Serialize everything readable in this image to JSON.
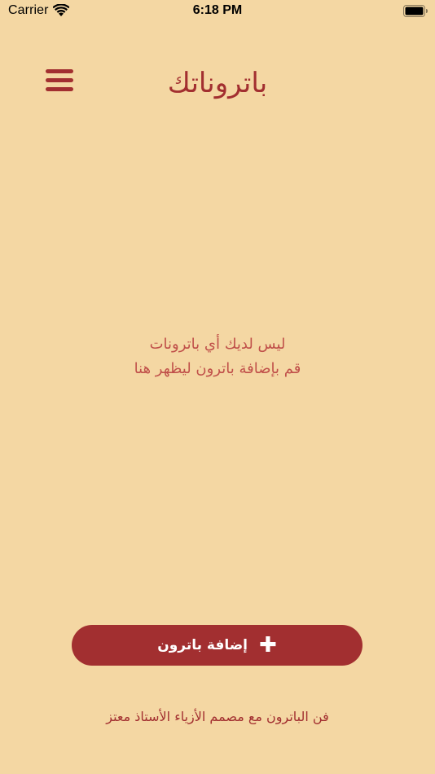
{
  "status_bar": {
    "carrier": "Carrier",
    "time": "6:18 PM",
    "wifi_icon": "wifi-icon",
    "battery_icon": "battery-full-icon"
  },
  "header": {
    "menu_icon": "hamburger-menu-icon",
    "title": "باتروناتك"
  },
  "empty_state": {
    "line1": "ليس لديك أي باترونات",
    "line2": "قم بإضافة باترون ليظهر هنا"
  },
  "add_button": {
    "icon": "plus-icon",
    "label": "إضافة باترون"
  },
  "footer": {
    "credit": "فن الباترون مع مصمم الأزياء الأستاذ معتز"
  },
  "colors": {
    "background": "#F4D7A3",
    "accent": "#A22F30",
    "empty_text": "#C0504A",
    "button_text": "#FFFFFF"
  }
}
